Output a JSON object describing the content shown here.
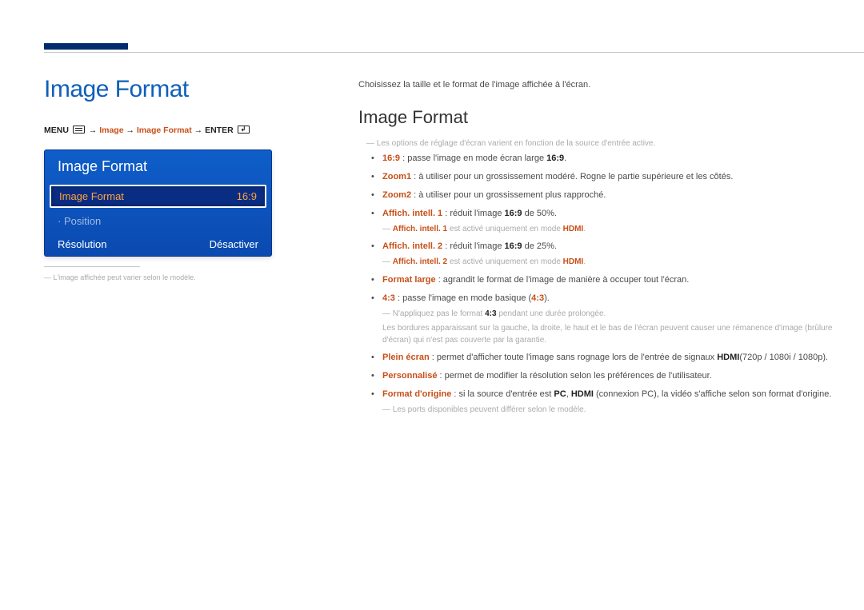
{
  "left": {
    "title": "Image Format",
    "breadcrumb": {
      "menu": "MENU",
      "arrow": " → ",
      "p1": "Image",
      "p2": "Image Format",
      "enter": "ENTER"
    },
    "panel": {
      "title": "Image Format",
      "rows": [
        {
          "label": "Image Format",
          "value": "16:9",
          "selected": true,
          "sub": false
        },
        {
          "label": "Position",
          "value": "",
          "selected": false,
          "sub": true,
          "dim": true
        },
        {
          "label": "Résolution",
          "value": "Désactiver",
          "selected": false,
          "sub": false
        }
      ]
    },
    "footnote": "L'image affichée peut varier selon le modèle."
  },
  "right": {
    "intro": "Choisissez la taille et le format de l'image affichée à l'écran.",
    "title": "Image Format",
    "topnote": "Les options de réglage d'écran varient en fonction de la source d'entrée active.",
    "items": {
      "i0": {
        "t1": "16:9",
        "rest": " : passe l'image en mode écran large ",
        "t2": "16:9",
        "end": "."
      },
      "i1": {
        "t1": "Zoom1",
        "rest": " : à utiliser pour un grossissement modéré. Rogne le partie supérieure et les côtés."
      },
      "i2": {
        "t1": "Zoom2",
        "rest": " : à utiliser pour un grossissement plus rapproché."
      },
      "i3": {
        "t1": "Affich. intell. 1",
        "rest": " : réduit l'image ",
        "t2": "16:9",
        "end": " de 50%."
      },
      "i3n": {
        "a": "Affich. intell. 1",
        "b": " est activé uniquement en mode ",
        "c": "HDMI",
        "d": "."
      },
      "i4": {
        "t1": "Affich. intell. 2",
        "rest": " : réduit l'image ",
        "t2": "16:9",
        "end": " de 25%."
      },
      "i4n": {
        "a": "Affich. intell. 2",
        "b": " est activé uniquement en mode ",
        "c": "HDMI",
        "d": "."
      },
      "i5": {
        "t1": "Format large",
        "rest": " : agrandit le format de l'image de manière à occuper tout l'écran."
      },
      "i6": {
        "t1": "4:3",
        "rest": " : passe l'image en mode basique (",
        "t2": "4:3",
        "end": ")."
      },
      "i6n1": {
        "a": "N'appliquez pas le format ",
        "b": "4:3",
        "c": " pendant une durée prolongée."
      },
      "i6n2": "Les bordures apparaissant sur la gauche, la droite, le haut et le bas de l'écran peuvent causer une rémanence d'image (brûlure d'écran) qui n'est pas couverte par la garantie.",
      "i7": {
        "t1": "Plein écran",
        "rest": " : permet d'afficher toute l'image sans rognage lors de l'entrée de signaux ",
        "t2": "HDMI",
        "end": "(720p / 1080i / 1080p)."
      },
      "i8": {
        "t1": "Personnalisé",
        "rest": " : permet de modifier la résolution selon les préférences de l'utilisateur."
      },
      "i9": {
        "t1": "Format d'origine",
        "rest": " : si la source d'entrée est ",
        "t2": "PC",
        "mid": ", ",
        "t3": "HDMI",
        "end": " (connexion PC), la vidéo s'affiche selon son format d'origine."
      },
      "i9n": "Les ports disponibles peuvent différer selon le modèle."
    }
  }
}
